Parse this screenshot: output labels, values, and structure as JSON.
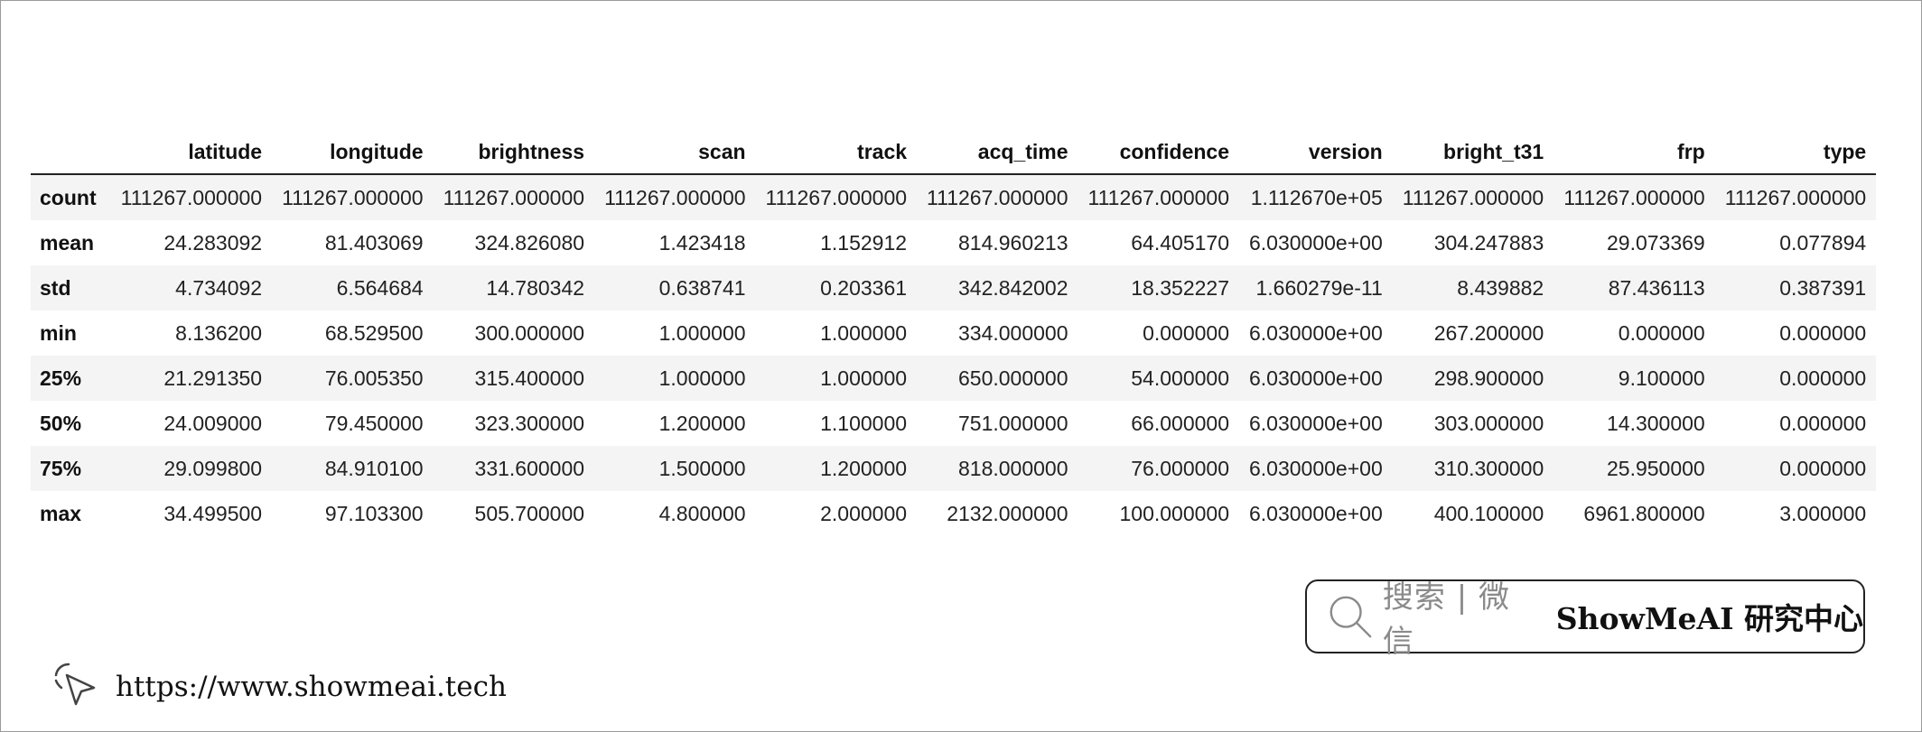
{
  "table": {
    "columns": [
      "latitude",
      "longitude",
      "brightness",
      "scan",
      "track",
      "acq_time",
      "confidence",
      "version",
      "bright_t31",
      "frp",
      "type"
    ],
    "rows": [
      {
        "label": "count",
        "values": [
          "111267.000000",
          "111267.000000",
          "111267.000000",
          "111267.000000",
          "111267.000000",
          "111267.000000",
          "111267.000000",
          "1.112670e+05",
          "111267.000000",
          "111267.000000",
          "111267.000000"
        ]
      },
      {
        "label": "mean",
        "values": [
          "24.283092",
          "81.403069",
          "324.826080",
          "1.423418",
          "1.152912",
          "814.960213",
          "64.405170",
          "6.030000e+00",
          "304.247883",
          "29.073369",
          "0.077894"
        ]
      },
      {
        "label": "std",
        "values": [
          "4.734092",
          "6.564684",
          "14.780342",
          "0.638741",
          "0.203361",
          "342.842002",
          "18.352227",
          "1.660279e-11",
          "8.439882",
          "87.436113",
          "0.387391"
        ]
      },
      {
        "label": "min",
        "values": [
          "8.136200",
          "68.529500",
          "300.000000",
          "1.000000",
          "1.000000",
          "334.000000",
          "0.000000",
          "6.030000e+00",
          "267.200000",
          "0.000000",
          "0.000000"
        ]
      },
      {
        "label": "25%",
        "values": [
          "21.291350",
          "76.005350",
          "315.400000",
          "1.000000",
          "1.000000",
          "650.000000",
          "54.000000",
          "6.030000e+00",
          "298.900000",
          "9.100000",
          "0.000000"
        ]
      },
      {
        "label": "50%",
        "values": [
          "24.009000",
          "79.450000",
          "323.300000",
          "1.200000",
          "1.100000",
          "751.000000",
          "66.000000",
          "6.030000e+00",
          "303.000000",
          "14.300000",
          "0.000000"
        ]
      },
      {
        "label": "75%",
        "values": [
          "29.099800",
          "84.910100",
          "331.600000",
          "1.500000",
          "1.200000",
          "818.000000",
          "76.000000",
          "6.030000e+00",
          "310.300000",
          "25.950000",
          "0.000000"
        ]
      },
      {
        "label": "max",
        "values": [
          "34.499500",
          "97.103300",
          "505.700000",
          "4.800000",
          "2.000000",
          "2132.000000",
          "100.000000",
          "6.030000e+00",
          "400.100000",
          "6961.800000",
          "3.000000"
        ]
      }
    ]
  },
  "search": {
    "icon": "search-icon",
    "hint": "搜索 | 微信",
    "brand": "ShowMeAI 研究中心"
  },
  "footer": {
    "icon": "cursor-click-icon",
    "url": "https://www.showmeai.tech"
  }
}
